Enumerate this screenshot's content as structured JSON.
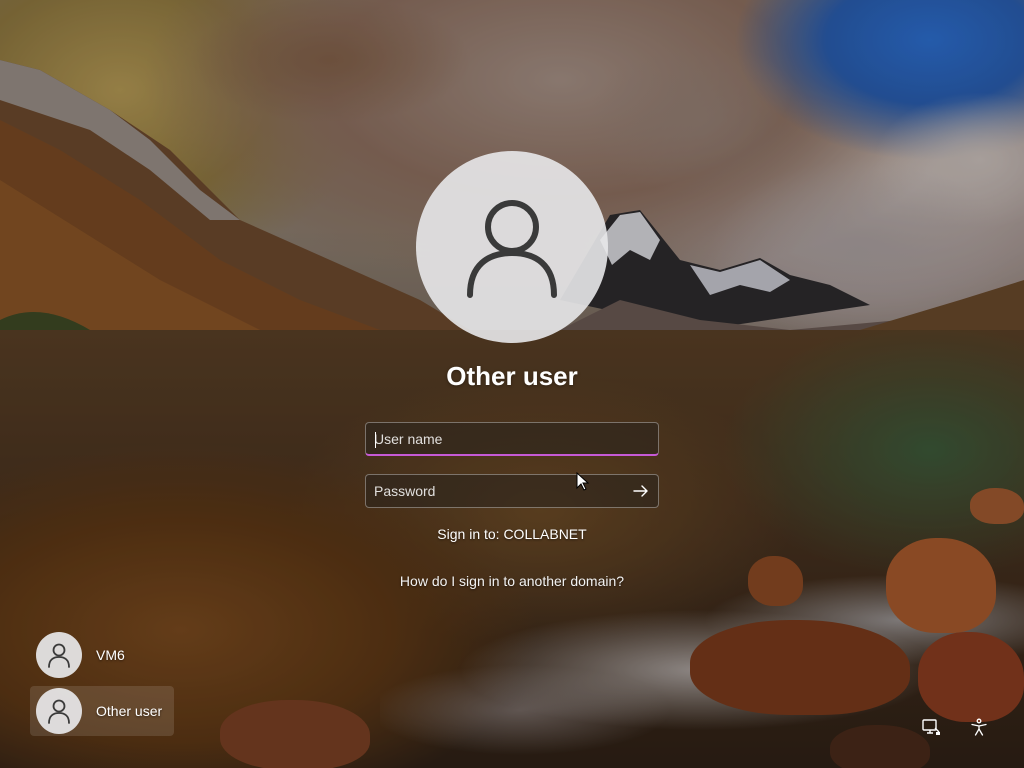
{
  "user_panel": {
    "display_name": "Other user",
    "username_placeholder": "User name",
    "username_value": "",
    "password_placeholder": "Password",
    "password_value": "",
    "sign_in_to": "Sign in to: COLLABNET",
    "domain_help_link": "How do I sign in to another domain?",
    "avatar_icon": "person-icon",
    "submit_icon": "arrow-right-icon"
  },
  "accounts": [
    {
      "label": "VM6",
      "icon": "person-icon",
      "selected": false
    },
    {
      "label": "Other user",
      "icon": "person-icon",
      "selected": true
    }
  ],
  "corner_icons": {
    "network": "network-icon",
    "accessibility": "accessibility-icon"
  },
  "colors": {
    "focus_accent": "#c65ad6",
    "avatar_bg": "#e8e8ea",
    "avatar_glyph": "#3a3a3a"
  }
}
